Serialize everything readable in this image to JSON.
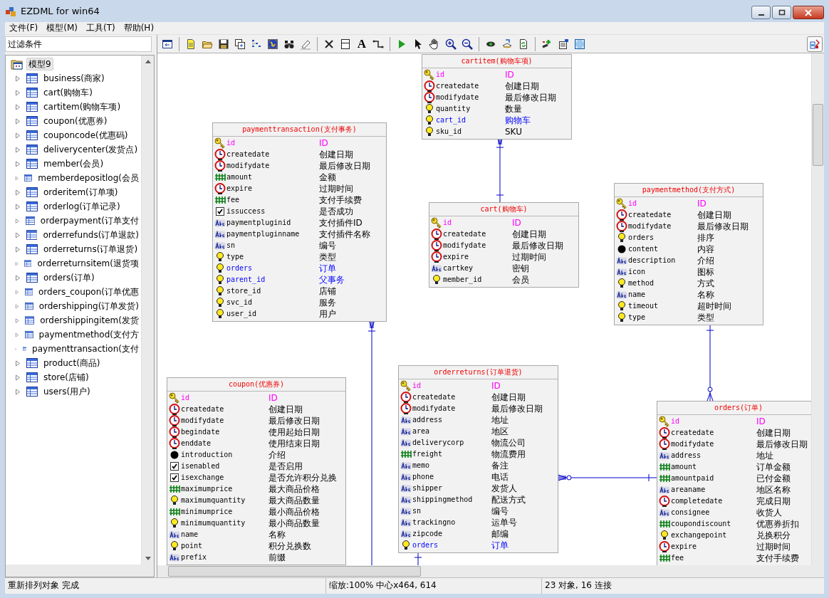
{
  "window": {
    "title": "EZDML for win64"
  },
  "menu": [
    "文件(F)",
    "模型(M)",
    "工具(T)",
    "帮助(H)"
  ],
  "filter_field": {
    "value": "过滤条件"
  },
  "toolbar": {
    "text_tool": "A"
  },
  "tree": {
    "label": "模型9",
    "selected": true,
    "children": [
      {
        "label": "business(商家)",
        "selected": false,
        "expanded": false
      },
      {
        "label": "cart(购物车)",
        "selected": false,
        "expanded": false
      },
      {
        "label": "cartitem(购物车项)",
        "selected": false,
        "expanded": false
      },
      {
        "label": "coupon(优惠券)",
        "selected": false,
        "expanded": false
      },
      {
        "label": "couponcode(优惠码)",
        "selected": false,
        "expanded": false
      },
      {
        "label": "deliverycenter(发货点)",
        "selected": false,
        "expanded": false
      },
      {
        "label": "member(会员)",
        "selected": false,
        "expanded": false
      },
      {
        "label": "memberdepositlog(会员",
        "selected": false,
        "expanded": false
      },
      {
        "label": "orderitem(订单项)",
        "selected": false,
        "expanded": false
      },
      {
        "label": "orderlog(订单记录)",
        "selected": false,
        "expanded": false
      },
      {
        "label": "orderpayment(订单支付",
        "selected": false,
        "expanded": false
      },
      {
        "label": "orderrefunds(订单退款)",
        "selected": false,
        "expanded": false
      },
      {
        "label": "orderreturns(订单退货)",
        "selected": false,
        "expanded": false
      },
      {
        "label": "orderreturnsitem(退货项",
        "selected": false,
        "expanded": false
      },
      {
        "label": "orders(订单)",
        "selected": false,
        "expanded": false
      },
      {
        "label": "orders_coupon(订单优惠",
        "selected": false,
        "expanded": false
      },
      {
        "label": "ordershipping(订单发货)",
        "selected": false,
        "expanded": false
      },
      {
        "label": "ordershippingitem(发货",
        "selected": false,
        "expanded": false
      },
      {
        "label": "paymentmethod(支付方",
        "selected": false,
        "expanded": false
      },
      {
        "label": "paymenttransaction(支付",
        "selected": false,
        "expanded": false
      },
      {
        "label": "product(商品)",
        "selected": false,
        "expanded": false
      },
      {
        "label": "store(店铺)",
        "selected": false,
        "expanded": false
      },
      {
        "label": "users(用户)",
        "selected": false,
        "expanded": false
      }
    ]
  },
  "entities": [
    {
      "title": "cartitem(购物车项)",
      "fields": [
        {
          "kind": "key",
          "name": "id",
          "comment": "ID",
          "foreign": false
        },
        {
          "kind": "date",
          "name": "createdate",
          "comment": "创建日期",
          "foreign": false
        },
        {
          "kind": "date",
          "name": "modifydate",
          "comment": "最后修改日期",
          "foreign": false
        },
        {
          "kind": "int",
          "name": "quantity",
          "comment": "数量",
          "foreign": false
        },
        {
          "kind": "int",
          "name": "cart_id",
          "comment": "购物车",
          "foreign": true
        },
        {
          "kind": "int",
          "name": "sku_id",
          "comment": "SKU",
          "foreign": false
        }
      ]
    },
    {
      "title": "paymenttransaction(支付事务)",
      "fields": [
        {
          "kind": "key",
          "name": "id",
          "comment": "ID",
          "foreign": false
        },
        {
          "kind": "date",
          "name": "createdate",
          "comment": "创建日期",
          "foreign": false
        },
        {
          "kind": "date",
          "name": "modifydate",
          "comment": "最后修改日期",
          "foreign": false
        },
        {
          "kind": "money",
          "name": "amount",
          "comment": "金额",
          "foreign": false
        },
        {
          "kind": "date",
          "name": "expire",
          "comment": "过期时间",
          "foreign": false
        },
        {
          "kind": "money",
          "name": "fee",
          "comment": "支付手续费",
          "foreign": false
        },
        {
          "kind": "check",
          "name": "issuccess",
          "comment": "是否成功",
          "foreign": false
        },
        {
          "kind": "text",
          "name": "paymentpluginid",
          "comment": "支付插件ID",
          "foreign": false
        },
        {
          "kind": "text",
          "name": "paymentpluginname",
          "comment": "支付插件名称",
          "foreign": false
        },
        {
          "kind": "text",
          "name": "sn",
          "comment": "编号",
          "foreign": false
        },
        {
          "kind": "int",
          "name": "type",
          "comment": "类型",
          "foreign": false
        },
        {
          "kind": "int",
          "name": "orders",
          "comment": "订单",
          "foreign": true
        },
        {
          "kind": "int",
          "name": "parent_id",
          "comment": "父事务",
          "foreign": true
        },
        {
          "kind": "int",
          "name": "store_id",
          "comment": "店铺",
          "foreign": false
        },
        {
          "kind": "int",
          "name": "svc_id",
          "comment": "服务",
          "foreign": false
        },
        {
          "kind": "int",
          "name": "user_id",
          "comment": "用户",
          "foreign": false
        }
      ]
    },
    {
      "title": "cart(购物车)",
      "fields": [
        {
          "kind": "key",
          "name": "id",
          "comment": "ID",
          "foreign": false
        },
        {
          "kind": "date",
          "name": "createdate",
          "comment": "创建日期",
          "foreign": false
        },
        {
          "kind": "date",
          "name": "modifydate",
          "comment": "最后修改日期",
          "foreign": false
        },
        {
          "kind": "date",
          "name": "expire",
          "comment": "过期时间",
          "foreign": false
        },
        {
          "kind": "text",
          "name": "cartkey",
          "comment": "密钥",
          "foreign": false
        },
        {
          "kind": "int",
          "name": "member_id",
          "comment": "会员",
          "foreign": false
        }
      ]
    },
    {
      "title": "paymentmethod(支付方式)",
      "fields": [
        {
          "kind": "key",
          "name": "id",
          "comment": "ID",
          "foreign": false
        },
        {
          "kind": "date",
          "name": "createdate",
          "comment": "创建日期",
          "foreign": false
        },
        {
          "kind": "date",
          "name": "modifydate",
          "comment": "最后修改日期",
          "foreign": false
        },
        {
          "kind": "int",
          "name": "orders",
          "comment": "排序",
          "foreign": false
        },
        {
          "kind": "blob",
          "name": "content",
          "comment": "内容",
          "foreign": false
        },
        {
          "kind": "text",
          "name": "description",
          "comment": "介绍",
          "foreign": false
        },
        {
          "kind": "text",
          "name": "icon",
          "comment": "图标",
          "foreign": false
        },
        {
          "kind": "int",
          "name": "method",
          "comment": "方式",
          "foreign": false
        },
        {
          "kind": "text",
          "name": "name",
          "comment": "名称",
          "foreign": false
        },
        {
          "kind": "int",
          "name": "timeout",
          "comment": "超时时间",
          "foreign": false
        },
        {
          "kind": "int",
          "name": "type",
          "comment": "类型",
          "foreign": false
        }
      ]
    },
    {
      "title": "coupon(优惠券)",
      "fields": [
        {
          "kind": "key",
          "name": "id",
          "comment": "ID",
          "foreign": false
        },
        {
          "kind": "date",
          "name": "createdate",
          "comment": "创建日期",
          "foreign": false
        },
        {
          "kind": "date",
          "name": "modifydate",
          "comment": "最后修改日期",
          "foreign": false
        },
        {
          "kind": "date",
          "name": "begindate",
          "comment": "使用起始日期",
          "foreign": false
        },
        {
          "kind": "date",
          "name": "enddate",
          "comment": "使用结束日期",
          "foreign": false
        },
        {
          "kind": "blob",
          "name": "introduction",
          "comment": "介绍",
          "foreign": false
        },
        {
          "kind": "check",
          "name": "isenabled",
          "comment": "是否启用",
          "foreign": false
        },
        {
          "kind": "check",
          "name": "isexchange",
          "comment": "是否允许积分兑换",
          "foreign": false
        },
        {
          "kind": "money",
          "name": "maximumprice",
          "comment": "最大商品价格",
          "foreign": false
        },
        {
          "kind": "int",
          "name": "maximumquantity",
          "comment": "最大商品数量",
          "foreign": false
        },
        {
          "kind": "money",
          "name": "minimumprice",
          "comment": "最小商品价格",
          "foreign": false
        },
        {
          "kind": "int",
          "name": "minimumquantity",
          "comment": "最小商品数量",
          "foreign": false
        },
        {
          "kind": "text",
          "name": "name",
          "comment": "名称",
          "foreign": false
        },
        {
          "kind": "int",
          "name": "point",
          "comment": "积分兑换数",
          "foreign": false
        },
        {
          "kind": "text",
          "name": "prefix",
          "comment": "前缀",
          "foreign": false
        }
      ]
    },
    {
      "title": "orderreturns(订单退货)",
      "fields": [
        {
          "kind": "key",
          "name": "id",
          "comment": "ID",
          "foreign": false
        },
        {
          "kind": "date",
          "name": "createdate",
          "comment": "创建日期",
          "foreign": false
        },
        {
          "kind": "date",
          "name": "modifydate",
          "comment": "最后修改日期",
          "foreign": false
        },
        {
          "kind": "text",
          "name": "address",
          "comment": "地址",
          "foreign": false
        },
        {
          "kind": "text",
          "name": "area",
          "comment": "地区",
          "foreign": false
        },
        {
          "kind": "text",
          "name": "deliverycorp",
          "comment": "物流公司",
          "foreign": false
        },
        {
          "kind": "money",
          "name": "freight",
          "comment": "物流费用",
          "foreign": false
        },
        {
          "kind": "text",
          "name": "memo",
          "comment": "备注",
          "foreign": false
        },
        {
          "kind": "text",
          "name": "phone",
          "comment": "电话",
          "foreign": false
        },
        {
          "kind": "text",
          "name": "shipper",
          "comment": "发货人",
          "foreign": false
        },
        {
          "kind": "text",
          "name": "shippingmethod",
          "comment": "配送方式",
          "foreign": false
        },
        {
          "kind": "text",
          "name": "sn",
          "comment": "编号",
          "foreign": false
        },
        {
          "kind": "text",
          "name": "trackingno",
          "comment": "运单号",
          "foreign": false
        },
        {
          "kind": "text",
          "name": "zipcode",
          "comment": "邮编",
          "foreign": false
        },
        {
          "kind": "int",
          "name": "orders",
          "comment": "订单",
          "foreign": true
        }
      ]
    },
    {
      "title": "orders(订单)",
      "fields": [
        {
          "kind": "key",
          "name": "id",
          "comment": "ID",
          "foreign": false
        },
        {
          "kind": "date",
          "name": "createdate",
          "comment": "创建日期",
          "foreign": false
        },
        {
          "kind": "date",
          "name": "modifydate",
          "comment": "最后修改日期",
          "foreign": false
        },
        {
          "kind": "text",
          "name": "address",
          "comment": "地址",
          "foreign": false
        },
        {
          "kind": "money",
          "name": "amount",
          "comment": "订单金额",
          "foreign": false
        },
        {
          "kind": "money",
          "name": "amountpaid",
          "comment": "已付金额",
          "foreign": false
        },
        {
          "kind": "text",
          "name": "areaname",
          "comment": "地区名称",
          "foreign": false
        },
        {
          "kind": "date",
          "name": "completedate",
          "comment": "完成日期",
          "foreign": false
        },
        {
          "kind": "text",
          "name": "consignee",
          "comment": "收货人",
          "foreign": false
        },
        {
          "kind": "money",
          "name": "coupondiscount",
          "comment": "优惠券折扣",
          "foreign": false
        },
        {
          "kind": "int",
          "name": "exchangepoint",
          "comment": "兑换积分",
          "foreign": false
        },
        {
          "kind": "date",
          "name": "expire",
          "comment": "过期时间",
          "foreign": false
        },
        {
          "kind": "money",
          "name": "fee",
          "comment": "支付手续费",
          "foreign": false
        }
      ]
    }
  ],
  "status_bar": [
    "重新排列对象 完成",
    "缩放:100% 中心x464, 614",
    "23 对象, 16 连接"
  ]
}
